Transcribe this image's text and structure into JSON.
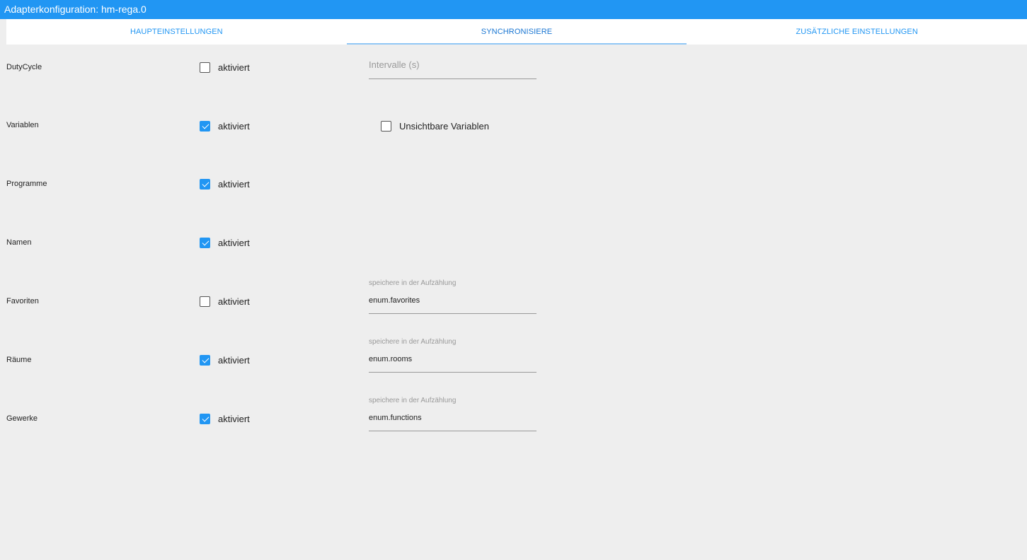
{
  "window": {
    "title": "Adapterkonfiguration: hm-rega.0"
  },
  "tabs": [
    {
      "label": "HAUPTEINSTELLUNGEN",
      "active": false
    },
    {
      "label": "SYNCHRONISIERE",
      "active": true
    },
    {
      "label": "ZUSÄTZLICHE EINSTELLUNGEN",
      "active": false
    }
  ],
  "rows": [
    {
      "label": "DutyCycle",
      "checkbox_label": "aktiviert",
      "checked": false
    },
    {
      "label": "Variablen",
      "checkbox_label": "aktiviert",
      "checked": true
    },
    {
      "label": "Programme",
      "checkbox_label": "aktiviert",
      "checked": true
    },
    {
      "label": "Namen",
      "checkbox_label": "aktiviert",
      "checked": true
    },
    {
      "label": "Favoriten",
      "checkbox_label": "aktiviert",
      "checked": false
    },
    {
      "label": "Räume",
      "checkbox_label": "aktiviert",
      "checked": true
    },
    {
      "label": "Gewerke",
      "checkbox_label": "aktiviert",
      "checked": true
    }
  ],
  "dutycycle_interval": {
    "placeholder": "Intervalle (s)",
    "value": ""
  },
  "invisible_variables": {
    "label": "Unsichtbare Variablen",
    "checked": false
  },
  "enum_fields": {
    "favorites": {
      "caption": "speichere in der Aufzählung",
      "value": "enum.favorites"
    },
    "rooms": {
      "caption": "speichere in der Aufzählung",
      "value": "enum.rooms"
    },
    "functions": {
      "caption": "speichere in der Aufzählung",
      "value": "enum.functions"
    }
  },
  "colors": {
    "accent": "#2196f3",
    "background": "#eeeeee"
  }
}
